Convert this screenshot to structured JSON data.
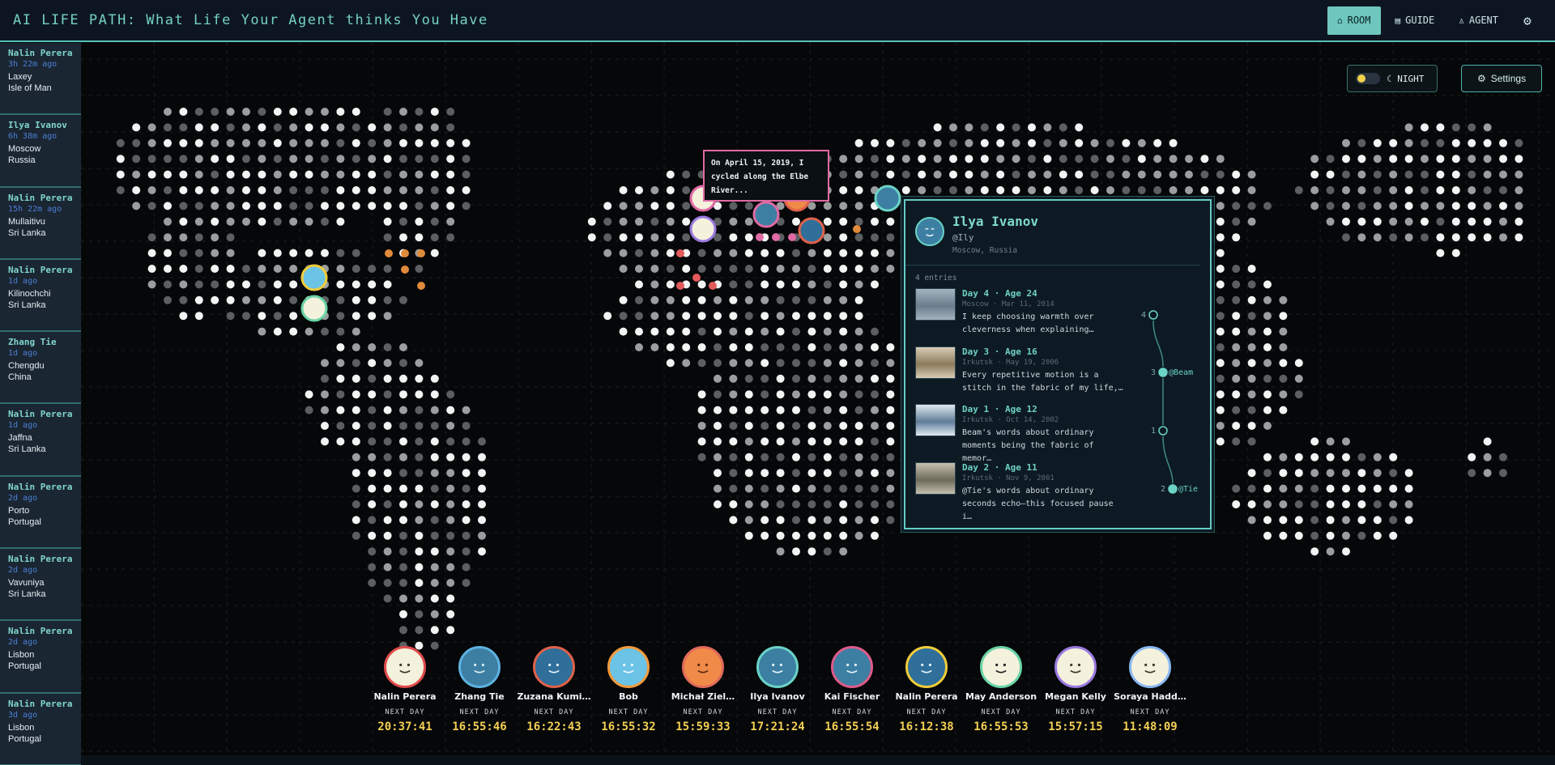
{
  "app": {
    "title": "AI LIFE PATH: What Life Your Agent thinks You Have"
  },
  "nav": {
    "room": "ROOM",
    "guide": "GUIDE",
    "agent": "AGENT"
  },
  "controls": {
    "theme_toggle": "☾ NIGHT",
    "settings": "Settings"
  },
  "feed": [
    {
      "name": "Nalin Perera",
      "ago": "3h 22m ago",
      "loc1": "Laxey",
      "loc2": "Isle of Man"
    },
    {
      "name": "Ilya Ivanov",
      "ago": "6h 38m ago",
      "loc1": "Moscow",
      "loc2": "Russia"
    },
    {
      "name": "Nalin Perera",
      "ago": "15h 22m ago",
      "loc1": "Mullaitivu",
      "loc2": "Sri Lanka"
    },
    {
      "name": "Nalin Perera",
      "ago": "1d ago",
      "loc1": "Kilinochchi",
      "loc2": "Sri Lanka"
    },
    {
      "name": "Zhang Tie",
      "ago": "1d ago",
      "loc1": "Chengdu",
      "loc2": "China"
    },
    {
      "name": "Nalin Perera",
      "ago": "1d ago",
      "loc1": "Jaffna",
      "loc2": "Sri Lanka"
    },
    {
      "name": "Nalin Perera",
      "ago": "2d ago",
      "loc1": "Porto",
      "loc2": "Portugal"
    },
    {
      "name": "Nalin Perera",
      "ago": "2d ago",
      "loc1": "Vavuniya",
      "loc2": "Sri Lanka"
    },
    {
      "name": "Nalin Perera",
      "ago": "2d ago",
      "loc1": "Lisbon",
      "loc2": "Portugal"
    },
    {
      "name": "Nalin Perera",
      "ago": "3d ago",
      "loc1": "Lisbon",
      "loc2": "Portugal"
    }
  ],
  "story_tooltip": {
    "line1": "On April 15, 2019, I",
    "line2": "cycled along the Elbe",
    "line3": "River..."
  },
  "profile": {
    "name": "Ilya Ivanov",
    "handle": "@Ily",
    "location": "Moscow, Russia",
    "entries_count": "4 entries",
    "entries": [
      {
        "title": "Day 4 · Age 24",
        "meta": "Moscow · Mar 11, 2014",
        "text1": "I keep choosing warmth over",
        "text2": "cleverness when explaining…",
        "node_label": "4",
        "tag": ""
      },
      {
        "title": "Day 3 · Age 16",
        "meta": "Irkutsk · May 19, 2006",
        "text1": "Every repetitive motion is a",
        "text2": "stitch in the fabric of my life,…",
        "node_label": "3",
        "tag": "@Beam"
      },
      {
        "title": "Day 1 · Age 12",
        "meta": "Irkutsk · Oct 14, 2002",
        "text1": "Beam's words about ordinary",
        "text2": "moments being the fabric of memor…",
        "node_label": "1",
        "tag": ""
      },
      {
        "title": "Day 2 · Age 11",
        "meta": "Irkutsk · Nov 9, 2001",
        "text1": "@Tie's words about ordinary",
        "text2": "seconds echo—this focused pause i…",
        "node_label": "2",
        "tag": "@Tie"
      }
    ]
  },
  "roster": [
    {
      "name": "Nalin Perera",
      "next": "NEXT DAY",
      "time": "20:37:41",
      "ring": "#e04a4a",
      "face": "#f4f1dc",
      "ink": "#3a3a2a"
    },
    {
      "name": "Zhang Tie",
      "next": "NEXT DAY",
      "time": "16:55:46",
      "ring": "#5eb2e0",
      "face": "#3d7fa3",
      "ink": "#d7ecf4"
    },
    {
      "name": "Zuzana Kumi…",
      "next": "NEXT DAY",
      "time": "16:22:43",
      "ring": "#e0614a",
      "face": "#2f6f9a",
      "ink": "#e8f2f8"
    },
    {
      "name": "Bob",
      "next": "NEXT DAY",
      "time": "16:55:32",
      "ring": "#f39a3a",
      "face": "#6bc3e6",
      "ink": "#eef8fc"
    },
    {
      "name": "Michał Ziel…",
      "next": "NEXT DAY",
      "time": "15:59:33",
      "ring": "#e06a5a",
      "face": "#f08a48",
      "ink": "#5a2a12"
    },
    {
      "name": "Ilya Ivanov",
      "next": "NEXT DAY",
      "time": "17:21:24",
      "ring": "#6ad3c6",
      "face": "#3d7fa3",
      "ink": "#e3f2f6"
    },
    {
      "name": "Kai Fischer",
      "next": "NEXT DAY",
      "time": "16:55:54",
      "ring": "#e05a8a",
      "face": "#3d7fa3",
      "ink": "#e3f2f6"
    },
    {
      "name": "Nalin Perera",
      "next": "NEXT DAY",
      "time": "16:12:38",
      "ring": "#f0cc3a",
      "face": "#2f6f9a",
      "ink": "#e3f2f6"
    },
    {
      "name": "May Anderson",
      "next": "NEXT DAY",
      "time": "16:55:53",
      "ring": "#6ad3a6",
      "face": "#f4f1dc",
      "ink": "#222222"
    },
    {
      "name": "Megan Kelly",
      "next": "NEXT DAY",
      "time": "15:57:15",
      "ring": "#9a7ae0",
      "face": "#f4f1dc",
      "ink": "#3a3a2a"
    },
    {
      "name": "Soraya Hadd…",
      "next": "NEXT DAY",
      "time": "11:48:09",
      "ring": "#8ab8f0",
      "face": "#f4f1dc",
      "ink": "#3a3a2a"
    }
  ],
  "colors": {
    "accent": "#6ec7bf",
    "countdown": "#f3cf53",
    "tooltip_border": "#e06aa4"
  }
}
